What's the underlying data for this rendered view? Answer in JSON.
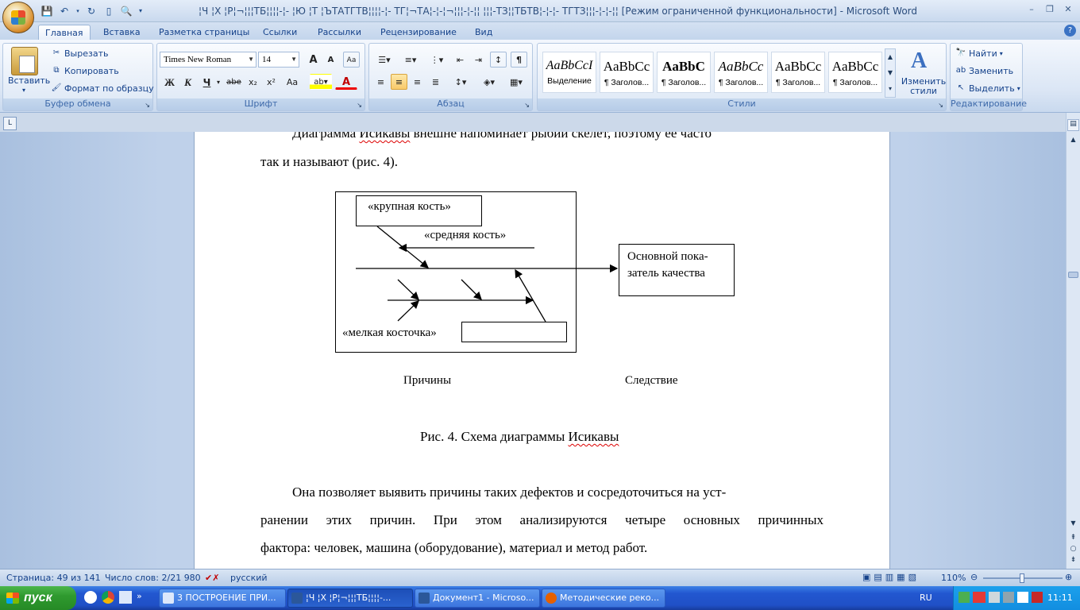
{
  "window": {
    "title": "¦Ч ¦Х ¦Р¦¬¦¦¦ТБ¦¦¦¦-¦- ¦Ю ¦Т ¦ЪТАТГТВ¦¦¦¦-¦- ТГ¦¬ТА¦-¦-¦¬¦¦¦-¦-¦¦ ¦¦¦-ТЗ¦¦ТБТВ¦-¦-¦- ТГТЗ¦¦¦-¦-¦-¦¦ [Режим ограниченной функциональности] - Microsoft Word"
  },
  "tabs": [
    "Главная",
    "Вставка",
    "Разметка страницы",
    "Ссылки",
    "Рассылки",
    "Рецензирование",
    "Вид"
  ],
  "clipboard": {
    "paste": "Вставить",
    "cut": "Вырезать",
    "copy": "Копировать",
    "format_painter": "Формат по образцу",
    "label": "Буфер обмена"
  },
  "font": {
    "name": "Times New Roman",
    "size": "14",
    "label": "Шрифт",
    "bold": "Ж",
    "italic": "К",
    "underline": "Ч",
    "strike": "abe",
    "sub": "x₂",
    "sup": "x²",
    "case": "Aa",
    "grow": "A",
    "shrink": "A"
  },
  "paragraph": {
    "label": "Абзац",
    "pilcrow": "¶"
  },
  "styles": {
    "label": "Стили",
    "items": [
      {
        "preview": "AaBbCcI",
        "name": "Выделение"
      },
      {
        "preview": "AaBbCc",
        "name": "¶ Заголов..."
      },
      {
        "preview": "AaBbC",
        "name": "¶ Заголов..."
      },
      {
        "preview": "AaBbCc",
        "name": "¶ Заголов..."
      },
      {
        "preview": "AaBbCc",
        "name": "¶ Заголов..."
      },
      {
        "preview": "AaBbCc",
        "name": "¶ Заголов..."
      }
    ],
    "change": "Изменить стили"
  },
  "editing": {
    "find": "Найти",
    "replace": "Заменить",
    "select": "Выделить",
    "label": "Редактирование"
  },
  "document": {
    "para1_line1": "Диаграмма Исикавы внешне напоминает рыбий скелет, поэтому ее часто",
    "para1_line2": "так и называют (рис. 4).",
    "diagram": {
      "big_bone": "«крупная кость»",
      "mid_bone": "«средняя кость»",
      "small_bone": "«мелкая косточка»",
      "result_box": "Основной пока-\nзатель качества",
      "causes": "Причины",
      "effect": "Следствие"
    },
    "caption": "Рис. 4. Схема диаграммы Исикавы",
    "para2_line1": "Она позволяет выявить причины таких дефектов и сосредоточиться на уст-",
    "para2_line2": "ранении этих причин. При этом анализируются четыре основных причинных",
    "para2_line3": "фактора: человек, машина (оборудование), материал и метод работ."
  },
  "status": {
    "page": "Страница: 49 из 141",
    "words": "Число слов: 2/21 980",
    "lang": "русский",
    "zoom": "110%"
  },
  "taskbar": {
    "start": "пуск",
    "tasks": [
      "3 ПОСТРОЕНИЕ ПРИ...",
      "¦Ч ¦Х ¦Р¦¬¦¦¦ТБ¦¦¦¦-...",
      "Документ1 - Microso...",
      "Методические реко..."
    ],
    "lang": "RU",
    "clock": "11:11"
  },
  "colors": {
    "ribbon_blue": "#c9d9ee",
    "taskbar_blue": "#2257d0",
    "start_green": "#2f9a2f"
  }
}
